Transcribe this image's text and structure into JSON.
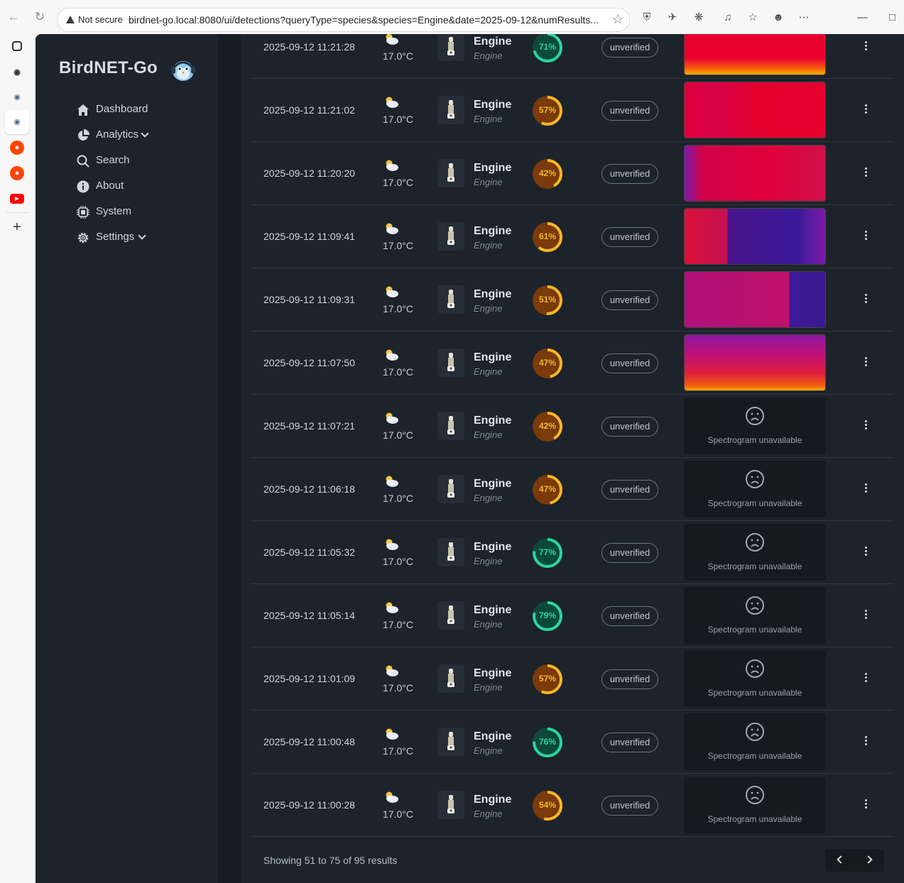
{
  "browser": {
    "security_label": "Not secure",
    "url": "birdnet-go.local:8080/ui/detections?queryType=species&species=Engine&date=2025-09-12&numResults..."
  },
  "app": {
    "logo": "BirdNET-Go",
    "nav": [
      {
        "label": "Dashboard",
        "icon": "home-icon"
      },
      {
        "label": "Analytics",
        "icon": "pie-chart-icon"
      },
      {
        "label": "Search",
        "icon": "search-icon"
      },
      {
        "label": "About",
        "icon": "info-icon"
      },
      {
        "label": "System",
        "icon": "cpu-icon"
      },
      {
        "label": "Settings",
        "icon": "gear-icon"
      }
    ]
  },
  "detections": [
    {
      "time": "2025-09-12 11:21:28",
      "temp": "17.0°C",
      "name": "Engine",
      "sci": "Engine",
      "confidence": 71,
      "conf_label": "71%",
      "status": "unverified",
      "spectrogram": "a"
    },
    {
      "time": "2025-09-12 11:21:02",
      "temp": "17.0°C",
      "name": "Engine",
      "sci": "Engine",
      "confidence": 57,
      "conf_label": "57%",
      "status": "unverified",
      "spectrogram": "b"
    },
    {
      "time": "2025-09-12 11:20:20",
      "temp": "17.0°C",
      "name": "Engine",
      "sci": "Engine",
      "confidence": 42,
      "conf_label": "42%",
      "status": "unverified",
      "spectrogram": "c"
    },
    {
      "time": "2025-09-12 11:09:41",
      "temp": "17.0°C",
      "name": "Engine",
      "sci": "Engine",
      "confidence": 61,
      "conf_label": "61%",
      "status": "unverified",
      "spectrogram": "d"
    },
    {
      "time": "2025-09-12 11:09:31",
      "temp": "17.0°C",
      "name": "Engine",
      "sci": "Engine",
      "confidence": 51,
      "conf_label": "51%",
      "status": "unverified",
      "spectrogram": "e"
    },
    {
      "time": "2025-09-12 11:07:50",
      "temp": "17.0°C",
      "name": "Engine",
      "sci": "Engine",
      "confidence": 47,
      "conf_label": "47%",
      "status": "unverified",
      "spectrogram": "f"
    },
    {
      "time": "2025-09-12 11:07:21",
      "temp": "17.0°C",
      "name": "Engine",
      "sci": "Engine",
      "confidence": 42,
      "conf_label": "42%",
      "status": "unverified",
      "spectrogram": "none"
    },
    {
      "time": "2025-09-12 11:06:18",
      "temp": "17.0°C",
      "name": "Engine",
      "sci": "Engine",
      "confidence": 47,
      "conf_label": "47%",
      "status": "unverified",
      "spectrogram": "none"
    },
    {
      "time": "2025-09-12 11:05:32",
      "temp": "17.0°C",
      "name": "Engine",
      "sci": "Engine",
      "confidence": 77,
      "conf_label": "77%",
      "status": "unverified",
      "spectrogram": "none"
    },
    {
      "time": "2025-09-12 11:05:14",
      "temp": "17.0°C",
      "name": "Engine",
      "sci": "Engine",
      "confidence": 79,
      "conf_label": "79%",
      "status": "unverified",
      "spectrogram": "none"
    },
    {
      "time": "2025-09-12 11:01:09",
      "temp": "17.0°C",
      "name": "Engine",
      "sci": "Engine",
      "confidence": 57,
      "conf_label": "57%",
      "status": "unverified",
      "spectrogram": "none"
    },
    {
      "time": "2025-09-12 11:00:48",
      "temp": "17.0°C",
      "name": "Engine",
      "sci": "Engine",
      "confidence": 76,
      "conf_label": "76%",
      "status": "unverified",
      "spectrogram": "none"
    },
    {
      "time": "2025-09-12 11:00:28",
      "temp": "17.0°C",
      "name": "Engine",
      "sci": "Engine",
      "confidence": 54,
      "conf_label": "54%",
      "status": "unverified",
      "spectrogram": "none"
    }
  ],
  "spectrogram_unavailable": "Spectrogram unavailable",
  "pagination": {
    "summary": "Showing 51 to 75 of 95 results"
  },
  "colors": {
    "high": "#2dd4a0",
    "high_bg": "#0b4a3a",
    "mid": "#f5b62a",
    "mid_bg": "#7a3a0a",
    "accent": "#1d232a"
  }
}
